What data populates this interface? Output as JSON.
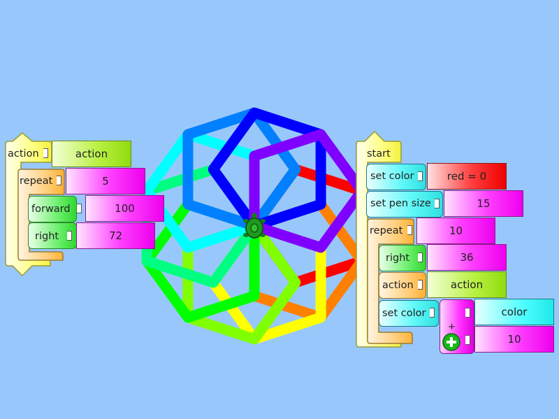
{
  "left_stack": {
    "action_block": {
      "label": "action",
      "arg": "action"
    },
    "repeat_block": {
      "label": "repeat",
      "arg": "5"
    },
    "forward_block": {
      "label": "forward",
      "arg": "100"
    },
    "right_block": {
      "label": "right",
      "arg": "72"
    }
  },
  "right_stack": {
    "start_block": {
      "label": "start"
    },
    "set_color_block": {
      "label": "set color",
      "arg": "red = 0"
    },
    "set_pen_size_block": {
      "label": "set pen size",
      "arg": "15"
    },
    "repeat_block": {
      "label": "repeat",
      "arg": "10"
    },
    "right_block": {
      "label": "right",
      "arg": "36"
    },
    "action_block": {
      "label": "action",
      "arg": "action"
    },
    "set_color_block_2": {
      "label": "set color"
    },
    "plus_block": {
      "label": "+",
      "arg1": "color",
      "arg2": "10"
    }
  },
  "canvas": {
    "turtle_icon": "turtle-icon",
    "stroke_colors": [
      "#ff0000",
      "#ff8000",
      "#ffff00",
      "#80ff00",
      "#00ff00",
      "#00ff80",
      "#00ffff",
      "#0080ff",
      "#0000ff",
      "#8000ff",
      "#ff00ff"
    ]
  },
  "colors": {
    "background": "#98c8fb",
    "start_block": "#ffff80",
    "repeat_block": "#ffc040",
    "turtle_block": "#40ff40",
    "pen_block": "#40ffff",
    "number_block": "#ff40ff",
    "action_block": "#c0f040"
  }
}
